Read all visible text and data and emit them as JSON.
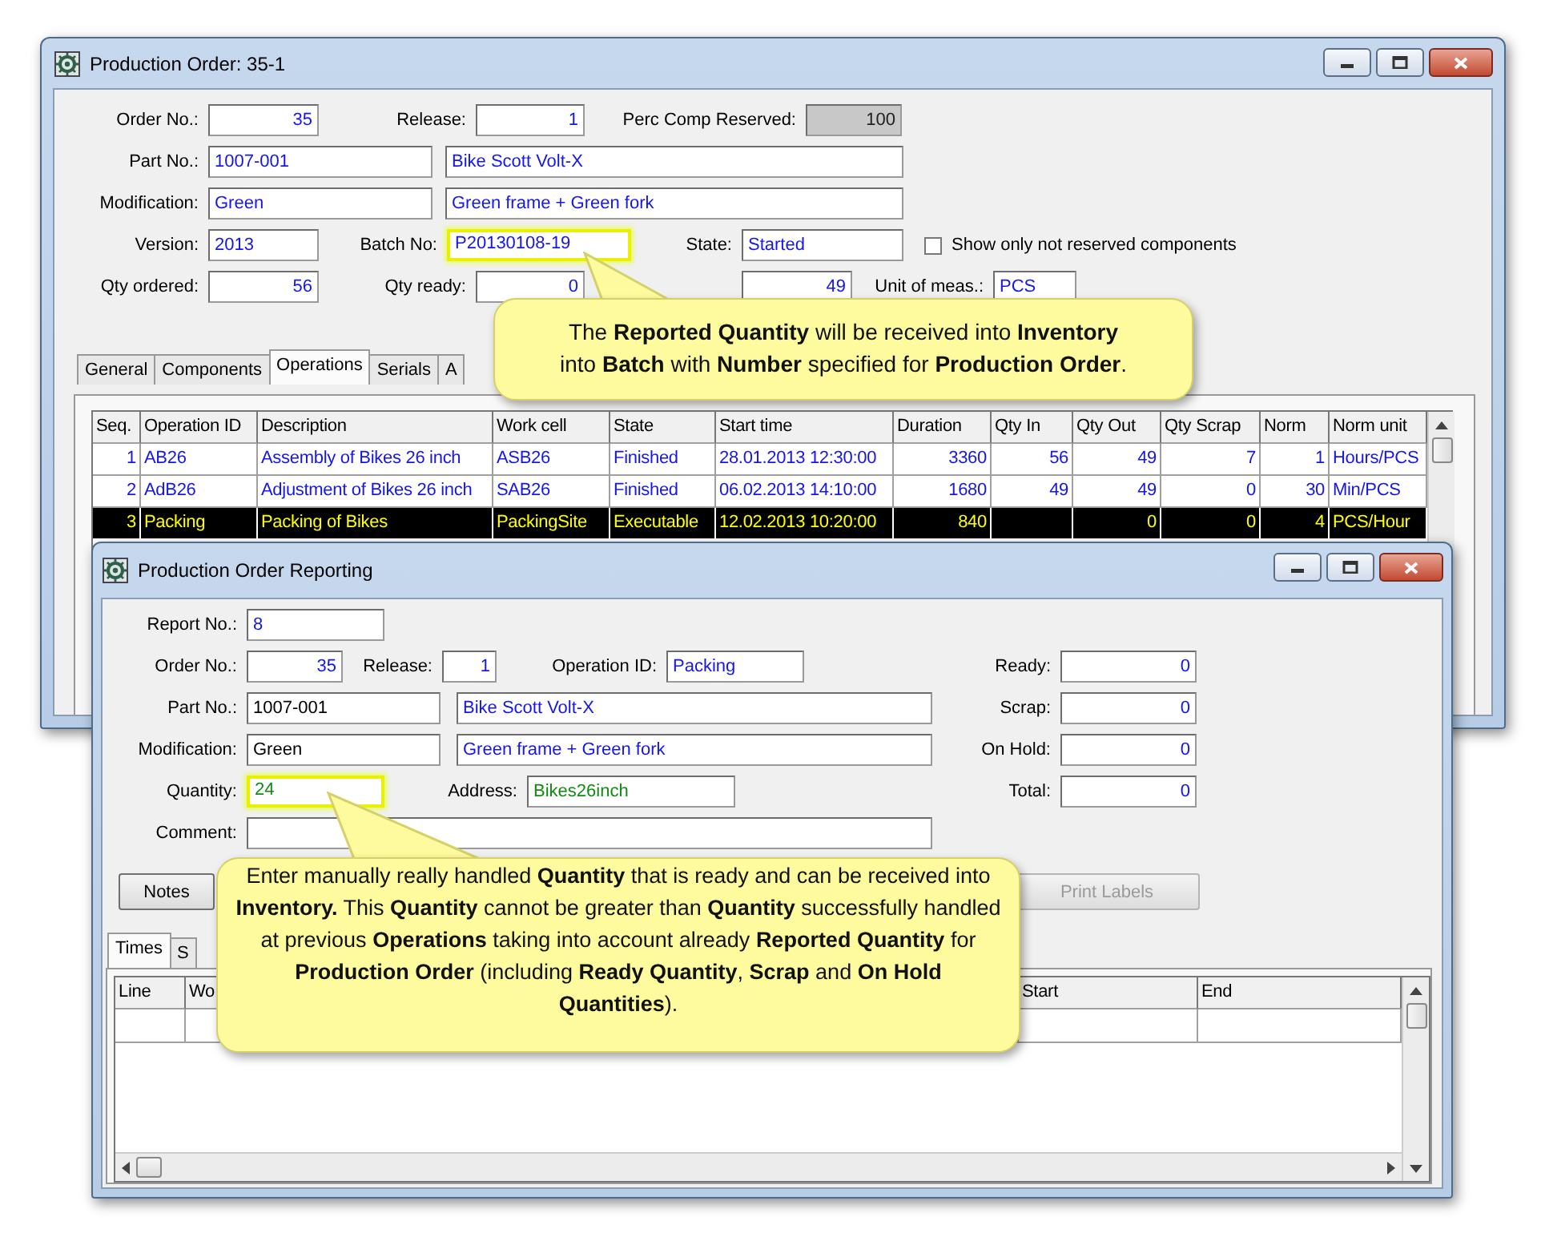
{
  "production_order_window": {
    "title": "Production Order: 35-1",
    "form_rows": [
      [
        {
          "kind": "number",
          "label": "Order No.:",
          "value": "35",
          "highlighted": false
        },
        {
          "kind": "number",
          "label": "Release:",
          "value": "1",
          "highlighted": false
        },
        {
          "kind": "readonly",
          "label": "Perc Comp Reserved:",
          "value": "100",
          "highlighted": false
        }
      ],
      [
        {
          "kind": "text",
          "label": "Part No.:",
          "value": "1007-001",
          "highlighted": false
        },
        {
          "kind": "text",
          "value": "Bike Scott Volt-X",
          "highlighted": false
        }
      ],
      [
        {
          "kind": "text",
          "label": "Modification:",
          "value": "Green",
          "highlighted": false
        },
        {
          "kind": "text",
          "value": "Green frame + Green fork",
          "highlighted": false
        }
      ],
      [
        {
          "kind": "text",
          "label": "Version:",
          "value": "2013",
          "highlighted": false
        },
        {
          "kind": "text",
          "label": "Batch No:",
          "value": "P20130108-19",
          "highlighted": true
        },
        {
          "kind": "text",
          "label": "State:",
          "value": "Started",
          "highlighted": false
        },
        {
          "kind": "checkbox",
          "label": "Show only not reserved components",
          "checked": false
        }
      ],
      [
        {
          "kind": "number",
          "label": "Qty ordered:",
          "value": "56",
          "highlighted": false
        },
        {
          "kind": "number",
          "label": "Qty ready:",
          "value": "0",
          "highlighted": false
        },
        {
          "kind": "number",
          "value": "49",
          "highlighted": false
        },
        {
          "kind": "text",
          "label": "Unit of meas.:",
          "value": "PCS",
          "highlighted": false
        }
      ]
    ],
    "tabs": [
      {
        "label": "General",
        "selected": false
      },
      {
        "label": "Components",
        "selected": false
      },
      {
        "label": "Operations",
        "selected": true
      },
      {
        "label": "Serials",
        "selected": false
      },
      {
        "label": "A",
        "selected": false
      }
    ],
    "operations_table": {
      "columns": [
        "Seq.",
        "Operation ID",
        "Description",
        "Work cell",
        "State",
        "Start time",
        "Duration",
        "Qty In",
        "Qty Out",
        "Qty Scrap",
        "Norm",
        "Norm unit"
      ],
      "rows": [
        {
          "selected": false,
          "cells": [
            "1",
            "AB26",
            "Assembly of Bikes 26 inch",
            "ASB26",
            "Finished",
            "28.01.2013 12:30:00",
            "3360",
            "56",
            "49",
            "7",
            "1",
            "Hours/PCS"
          ]
        },
        {
          "selected": false,
          "cells": [
            "2",
            "AdB26",
            "Adjustment of Bikes 26 inch",
            "SAB26",
            "Finished",
            "06.02.2013 14:10:00",
            "1680",
            "49",
            "49",
            "0",
            "30",
            "Min/PCS"
          ]
        },
        {
          "selected": true,
          "cells": [
            "3",
            "Packing",
            "Packing of Bikes",
            "PackingSite",
            "Executable",
            "12.02.2013 10:20:00",
            "840",
            null,
            "0",
            "0",
            "4",
            "PCS/Hour"
          ]
        }
      ]
    }
  },
  "reporting_window": {
    "title": "Production Order Reporting",
    "form_rows": [
      [
        {
          "kind": "text",
          "label": "Report No.:",
          "value": "8",
          "highlighted": false
        }
      ],
      [
        {
          "kind": "number",
          "label": "Order No.:",
          "value": "35",
          "highlighted": false
        },
        {
          "kind": "number",
          "label": "Release:",
          "value": "1",
          "highlighted": false
        },
        {
          "kind": "text",
          "label": "Operation ID:",
          "value": "Packing",
          "highlighted": false
        }
      ],
      [
        {
          "kind": "plain",
          "label": "Part No.:",
          "value": "1007-001",
          "highlighted": false
        },
        {
          "kind": "text",
          "value": "Bike Scott Volt-X",
          "highlighted": false
        }
      ],
      [
        {
          "kind": "plain",
          "label": "Modification:",
          "value": "Green",
          "highlighted": false
        },
        {
          "kind": "text",
          "value": "Green frame + Green fork",
          "highlighted": false
        }
      ],
      [
        {
          "kind": "entry",
          "label": "Quantity:",
          "value": "24",
          "highlighted": true
        },
        {
          "kind": "entry",
          "label": "Address:",
          "value": "Bikes26inch",
          "highlighted": false
        }
      ],
      [
        {
          "kind": "plain",
          "label": "Comment:",
          "highlighted": false
        }
      ]
    ],
    "totals": [
      {
        "kind": "number",
        "label": "Ready:",
        "value": "0",
        "highlighted": false
      },
      {
        "kind": "number",
        "label": "Scrap:",
        "value": "0",
        "highlighted": false
      },
      {
        "kind": "number",
        "label": "On Hold:",
        "value": "0",
        "highlighted": false
      },
      {
        "kind": "number",
        "label": "Total:",
        "value": "0",
        "highlighted": false
      }
    ],
    "buttons": [
      {
        "label": "Notes",
        "disabled": false
      },
      {
        "label": "Print Labels",
        "disabled": true
      }
    ],
    "tabs": [
      {
        "label": "Times",
        "selected": true
      },
      {
        "label": "S",
        "selected": false
      }
    ],
    "times_table": {
      "columns": [
        "Line",
        "Wo",
        "Start",
        "End"
      ]
    }
  },
  "callouts": [
    {
      "text": "The **Reported Quantity** will be received into **Inventory** into **Batch** with **Number** specified for **Production  Order**."
    },
    {
      "text": "Enter manually really handled **Quantity** that is ready and can be received into **Inventory.** This **Quantity** cannot be greater than **Quantity** successfully handled at previous **Operations** taking into account already **Reported Quantity** for **Production Order** (including **Ready Quantity**, **Scrap** and **On Hold Quantities**)."
    }
  ]
}
